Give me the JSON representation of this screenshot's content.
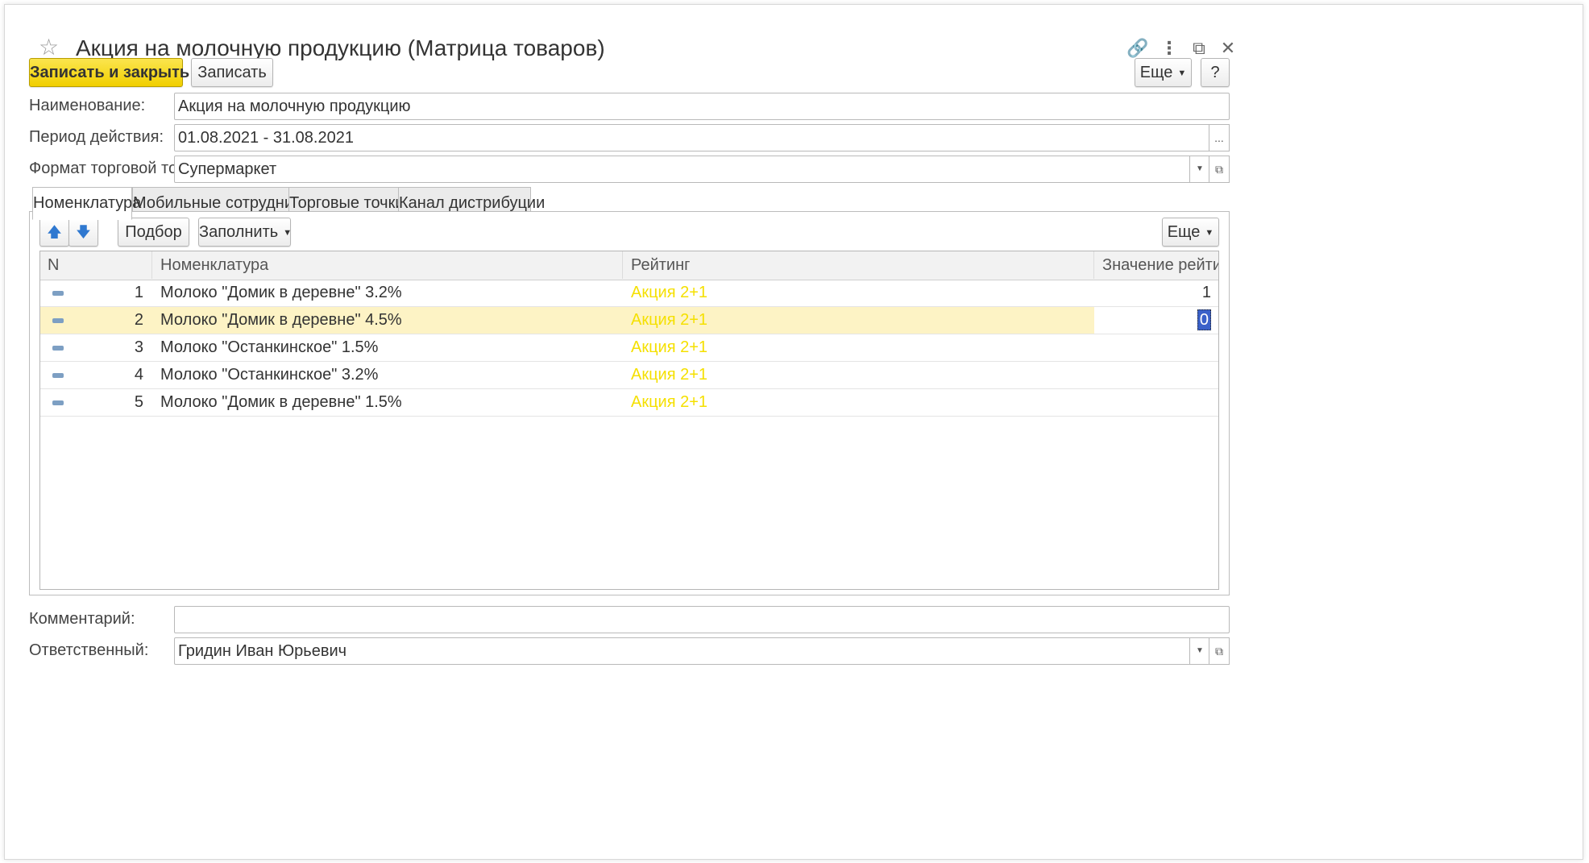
{
  "window": {
    "title": "Акция на молочную продукцию (Матрица товаров)",
    "star_icon": "☆",
    "link_icon": "🔗",
    "more_icon": "⋮",
    "maximize_icon": "⧉",
    "close_icon": "✕"
  },
  "toolbar": {
    "save_close_label": "Записать и закрыть",
    "save_label": "Записать",
    "more_label": "Еще",
    "help_label": "?"
  },
  "form": {
    "name_label": "Наименование:",
    "name_value": "Акция на молочную продукцию",
    "period_label": "Период действия:",
    "period_value": "01.08.2021 - 31.08.2021",
    "period_button": "...",
    "format_label": "Формат торговой точки:",
    "format_value": "Супермаркет",
    "comment_label": "Комментарий:",
    "comment_value": "",
    "responsible_label": "Ответственный:",
    "responsible_value": "Гридин Иван Юрьевич"
  },
  "tabs": [
    {
      "label": "Номенклатура",
      "active": true
    },
    {
      "label": "Мобильные сотрудники",
      "active": false
    },
    {
      "label": "Торговые точки",
      "active": false
    },
    {
      "label": "Канал дистрибуции",
      "active": false
    }
  ],
  "table_toolbar": {
    "up_icon": "🡅",
    "down_icon": "🡇",
    "pick_label": "Подбор",
    "fill_label": "Заполнить",
    "more_label": "Еще"
  },
  "table": {
    "columns": [
      "N",
      "Номенклатура",
      "Рейтинг",
      "Значение рейтинга"
    ],
    "rows": [
      {
        "n": "1",
        "item": "Молоко \"Домик в деревне\" 3.2%",
        "rating": "Акция 2+1",
        "value": "1"
      },
      {
        "n": "2",
        "item": "Молоко \"Домик в деревне\" 4.5%",
        "rating": "Акция 2+1",
        "value": "0"
      },
      {
        "n": "3",
        "item": "Молоко \"Останкинское\" 1.5%",
        "rating": "Акция 2+1",
        "value": ""
      },
      {
        "n": "4",
        "item": "Молоко \"Останкинское\" 3.2%",
        "rating": "Акция 2+1",
        "value": ""
      },
      {
        "n": "5",
        "item": "Молоко \"Домик в деревне\" 1.5%",
        "rating": "Акция 2+1",
        "value": ""
      }
    ]
  },
  "colors": {
    "primary_button": "#f1cf00",
    "rating_text": "#f5e000",
    "selected_row": "#fdf3c5"
  }
}
